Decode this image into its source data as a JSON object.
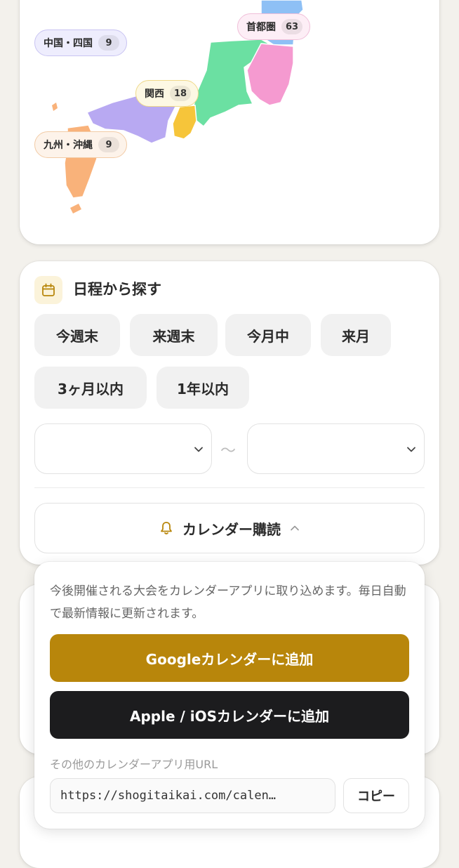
{
  "map": {
    "regions": [
      {
        "name": "中国・四国",
        "count": "9"
      },
      {
        "name": "首都圏",
        "count": "63"
      },
      {
        "name": "関西",
        "count": "18"
      },
      {
        "name": "九州・沖縄",
        "count": "9"
      }
    ],
    "colors": {
      "chugoku_shikoku": "#b8a9f2",
      "kansai": "#f6c53a",
      "chubu": "#6be0a2",
      "shutoken": "#f59ad0",
      "tohoku": "#8ec0f5",
      "kyushu": "#f9b27a"
    }
  },
  "schedule": {
    "title": "日程から探す",
    "icon": "calendar-icon",
    "chips": [
      "今週末",
      "来週末",
      "今月中",
      "来月",
      "3ヶ月以内",
      "1年以内"
    ],
    "date_separator": "〜",
    "from_date_value": "",
    "to_date_value": ""
  },
  "calendar_subscribe": {
    "toggle_label": "カレンダー購読",
    "toggle_icon": "bell-icon",
    "description": "今後開催される大会をカレンダーアプリに取り込めます。毎日自動で最新情報に更新されます。",
    "google_button": "Googleカレンダーに追加",
    "apple_button": "Apple / iOSカレンダーに追加",
    "url_label": "その他のカレンダーアプリ用URL",
    "url_value": "https://shogitaikai.com/calen…",
    "copy_button": "コピー"
  },
  "theme": {
    "accent": "#b8860b",
    "dark_button": "#1c1c1e"
  }
}
